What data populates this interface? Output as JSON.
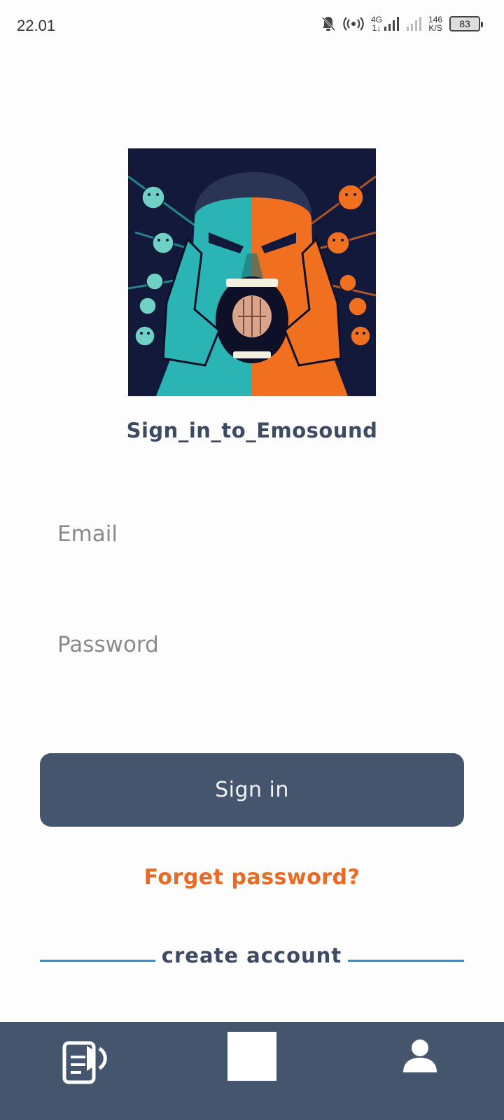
{
  "status_bar": {
    "time": "22.01",
    "network_type": "4G",
    "network_sub": "1↓",
    "speed_value": "146",
    "speed_unit": "K/S",
    "battery": "83"
  },
  "hero": {
    "icon": "screaming-man-microphone-illustration",
    "colors": {
      "left": "#2bb4b4",
      "right": "#f07020",
      "background": "#12193a"
    }
  },
  "page": {
    "title": "Sign_in_to_Emosound"
  },
  "form": {
    "email_placeholder": "Email",
    "password_placeholder": "Password",
    "signin_label": "Sign in",
    "forgot_label": "Forget password?",
    "create_label": "create account"
  },
  "colors": {
    "primary": "#46556e",
    "accent_orange": "#ea6a23",
    "divider_blue": "#2e8fe0",
    "title_text": "#3d4a63"
  },
  "bottom_nav": {
    "items": [
      {
        "icon": "document-audio-icon"
      },
      {
        "icon": "blank-square-icon"
      },
      {
        "icon": "profile-icon"
      }
    ]
  }
}
